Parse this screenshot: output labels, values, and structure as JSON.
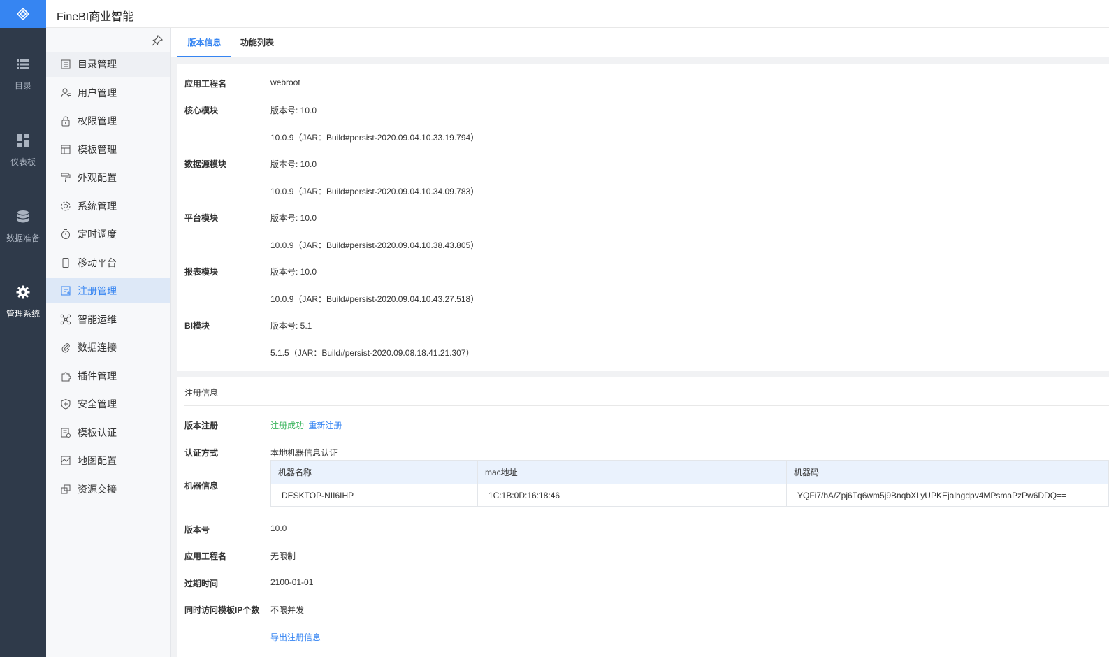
{
  "app": {
    "title": "FineBI商业智能"
  },
  "rail": {
    "items": [
      {
        "label": "目录",
        "icon": "list-icon"
      },
      {
        "label": "仪表板",
        "icon": "dashboard-icon"
      },
      {
        "label": "数据准备",
        "icon": "database-icon"
      },
      {
        "label": "管理系统",
        "icon": "gear-icon"
      }
    ]
  },
  "submenu": {
    "items": [
      {
        "label": "目录管理",
        "icon": "catalog-icon"
      },
      {
        "label": "用户管理",
        "icon": "user-icon"
      },
      {
        "label": "权限管理",
        "icon": "lock-icon"
      },
      {
        "label": "模板管理",
        "icon": "template-icon"
      },
      {
        "label": "外观配置",
        "icon": "paint-roller-icon"
      },
      {
        "label": "系统管理",
        "icon": "settings-icon"
      },
      {
        "label": "定时调度",
        "icon": "timer-icon"
      },
      {
        "label": "移动平台",
        "icon": "mobile-icon"
      },
      {
        "label": "注册管理",
        "icon": "register-icon"
      },
      {
        "label": "智能运维",
        "icon": "network-icon"
      },
      {
        "label": "数据连接",
        "icon": "paperclip-icon"
      },
      {
        "label": "插件管理",
        "icon": "puzzle-icon"
      },
      {
        "label": "安全管理",
        "icon": "shield-icon"
      },
      {
        "label": "模板认证",
        "icon": "certificate-icon"
      },
      {
        "label": "地图配置",
        "icon": "map-icon"
      },
      {
        "label": "资源交接",
        "icon": "handover-icon"
      }
    ]
  },
  "tabs": [
    {
      "label": "版本信息"
    },
    {
      "label": "功能列表"
    }
  ],
  "version": {
    "app_name_label": "应用工程名",
    "app_name": "webroot",
    "modules": [
      {
        "label": "核心模块",
        "version": "版本号: 10.0",
        "build": "10.0.9（JAR：Build#persist-2020.09.04.10.33.19.794）"
      },
      {
        "label": "数据源模块",
        "version": "版本号: 10.0",
        "build": "10.0.9（JAR：Build#persist-2020.09.04.10.34.09.783）"
      },
      {
        "label": "平台模块",
        "version": "版本号: 10.0",
        "build": "10.0.9（JAR：Build#persist-2020.09.04.10.38.43.805）"
      },
      {
        "label": "报表模块",
        "version": "版本号: 10.0",
        "build": "10.0.9（JAR：Build#persist-2020.09.04.10.43.27.518）"
      },
      {
        "label": "BI模块",
        "version": "版本号: 5.1",
        "build": "5.1.5（JAR：Build#persist-2020.09.08.18.41.21.307）"
      }
    ]
  },
  "registration": {
    "title": "注册信息",
    "version_reg_label": "版本注册",
    "status": "注册成功",
    "reregister": "重新注册",
    "auth_label": "认证方式",
    "auth_value": "本地机器信息认证",
    "machine_label": "机器信息",
    "table": {
      "headers": [
        "机器名称",
        "mac地址",
        "机器码"
      ],
      "row": [
        "DESKTOP-NII6IHP",
        "1C:1B:0D:16:18:46",
        "YQFi7/bA/Zpj6Tq6wm5j9BnqbXLyUPKEjalhgdpv4MPsmaPzPw6DDQ=="
      ]
    },
    "version_label": "版本号",
    "version_value": "10.0",
    "app_name_label": "应用工程名",
    "app_name_value": "无限制",
    "expire_label": "过期时间",
    "expire_value": "2100-01-01",
    "concurrent_label": "同时访问模板IP个数",
    "concurrent_value": "不限并发",
    "export_link": "导出注册信息"
  },
  "colors": {
    "accent": "#3685f2",
    "rail_bg": "#2f3a4a",
    "success": "#3cb55e"
  }
}
